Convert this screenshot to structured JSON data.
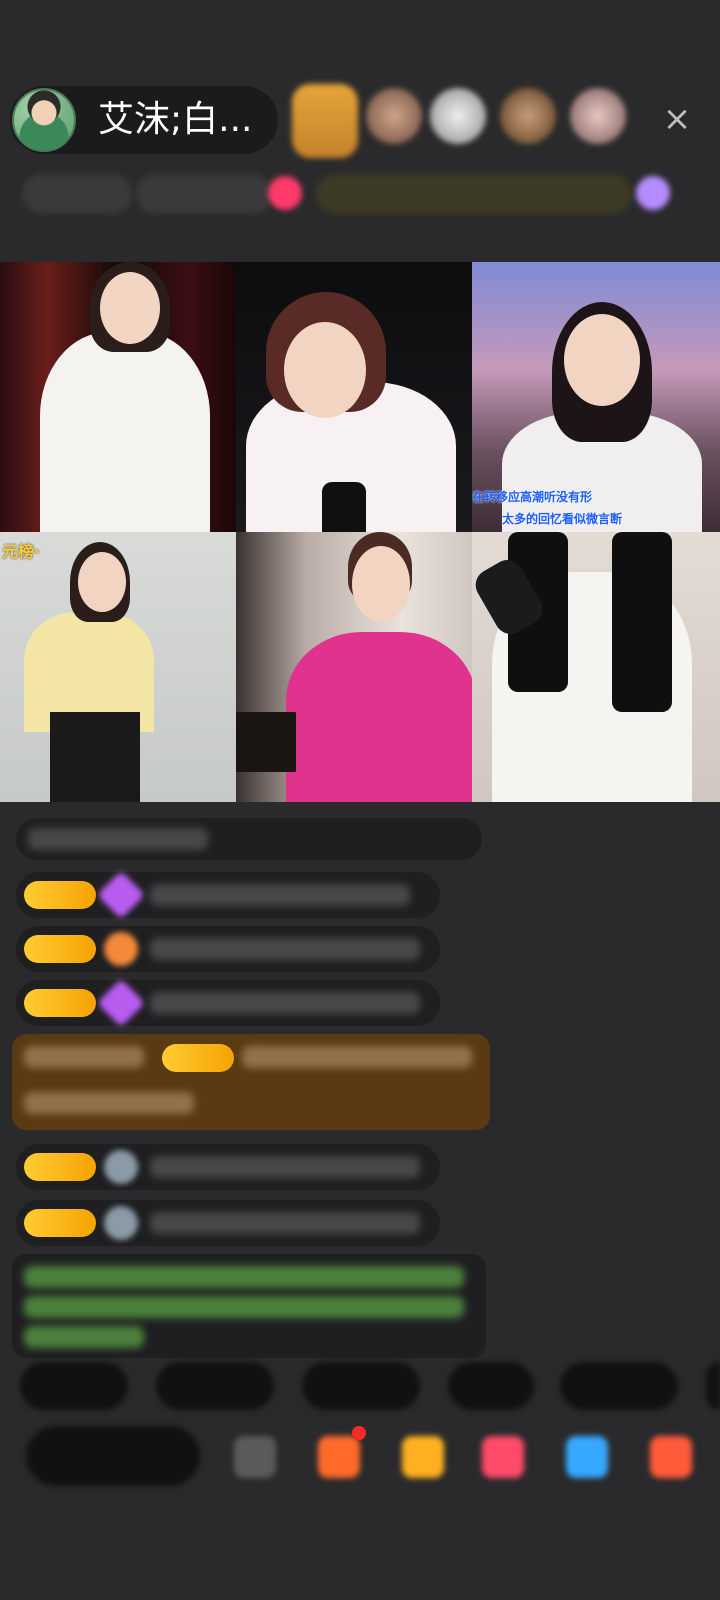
{
  "host": {
    "name": "艾沫;白..."
  },
  "video_captions": {
    "tile3_line1": "在转移应高潮听没有形",
    "tile3_line2": "太多的回忆看似微言断",
    "tile4_top": "元榜·"
  },
  "colors": {
    "background": "#2a2a2c",
    "badge_gold": "#f5a300",
    "gift_highlight": "#5a3a12",
    "system_green": "#6fcf52"
  },
  "icons": {
    "close": "×"
  }
}
